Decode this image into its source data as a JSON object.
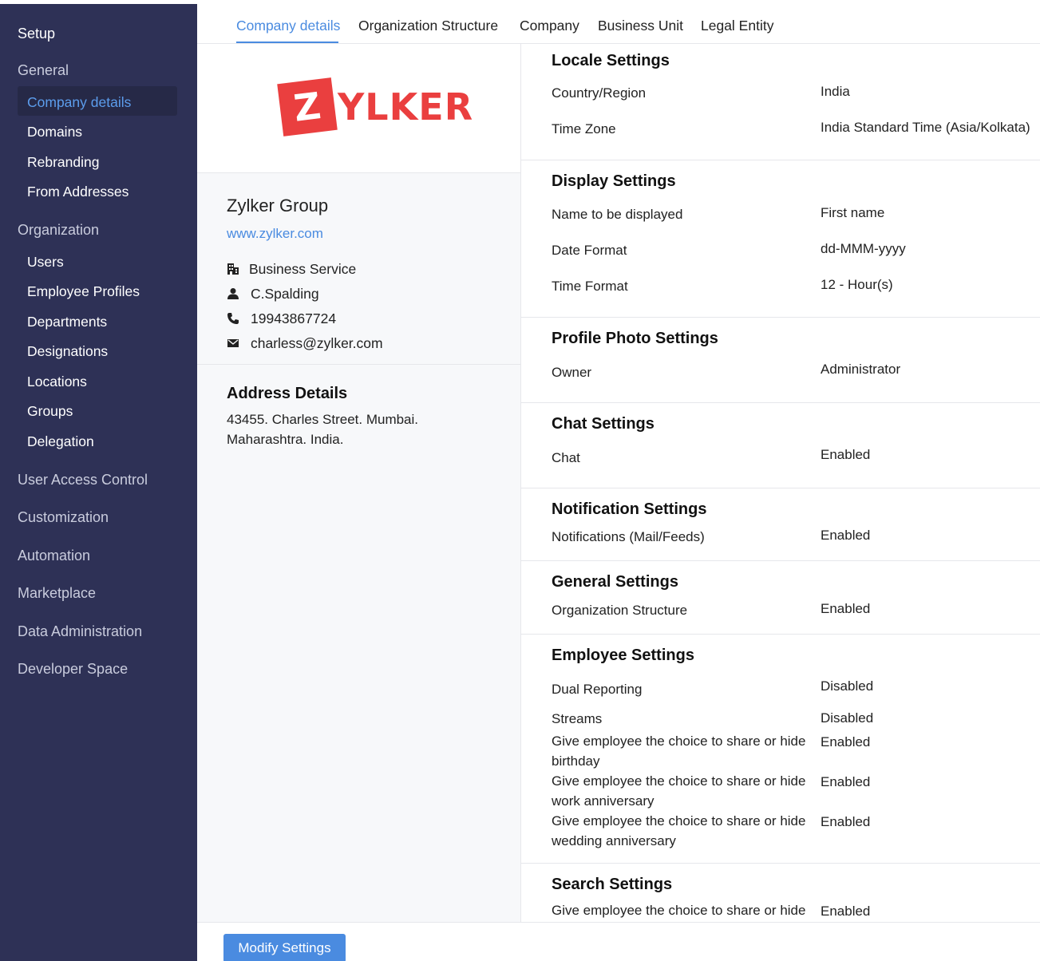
{
  "sidebar": {
    "setup": "Setup",
    "general": "General",
    "general_items": [
      "Company details",
      "Domains",
      "Rebranding",
      "From Addresses"
    ],
    "organization": "Organization",
    "organization_items": [
      "Users",
      "Employee Profiles",
      "Departments",
      "Designations",
      "Locations",
      "Groups",
      "Delegation"
    ],
    "groups": [
      "User Access Control",
      "Customization",
      "Automation",
      "Marketplace",
      "Data Administration",
      "Developer Space"
    ]
  },
  "tabs": [
    "Company details",
    "Organization Structure",
    "Company",
    "Business Unit",
    "Legal Entity"
  ],
  "company": {
    "logo_letter": "Z",
    "logo_text": "YLKER",
    "name": "Zylker Group",
    "url": "www.zylker.com",
    "industry": "Business Service",
    "owner": "C.Spalding",
    "phone": "19943867724",
    "email": "charless@zylker.com",
    "address_title": "Address Details",
    "address_line1": "43455. Charles Street. Mumbai.",
    "address_line2": "Maharashtra. India."
  },
  "settings": {
    "locale": {
      "title": "Locale Settings",
      "rows": [
        [
          "Country/Region",
          "India"
        ],
        [
          "Time Zone",
          "India Standard Time (Asia/Kolkata)"
        ]
      ]
    },
    "display": {
      "title": "Display Settings",
      "rows": [
        [
          "Name to be displayed",
          "First name"
        ],
        [
          "Date Format",
          "dd-MMM-yyyy"
        ],
        [
          "Time Format",
          "12 - Hour(s)"
        ]
      ]
    },
    "profile_photo": {
      "title": "Profile Photo Settings",
      "rows": [
        [
          "Owner",
          "Administrator"
        ]
      ]
    },
    "chat": {
      "title": "Chat Settings",
      "rows": [
        [
          "Chat",
          "Enabled"
        ]
      ]
    },
    "notification": {
      "title": "Notification Settings",
      "rows": [
        [
          "Notifications (Mail/Feeds)",
          "Enabled"
        ]
      ]
    },
    "general": {
      "title": "General Settings",
      "rows": [
        [
          "Organization Structure",
          "Enabled"
        ]
      ]
    },
    "employee": {
      "title": "Employee Settings",
      "rows": [
        [
          "Dual Reporting",
          "Disabled"
        ],
        [
          "Streams",
          "Disabled"
        ],
        [
          "Give employee the choice to share or hide birthday",
          "Enabled"
        ],
        [
          "Give employee the choice to share or hide work anniversary",
          "Enabled"
        ],
        [
          "Give employee the choice to share or hide wedding anniversary",
          "Enabled"
        ]
      ]
    },
    "search": {
      "title": "Search Settings",
      "rows": [
        [
          "Give employee the choice to share or hide",
          "Enabled"
        ]
      ]
    }
  },
  "footer": {
    "modify_button": "Modify Settings"
  },
  "colors": {
    "sidebar_bg": "#2e3156",
    "accent": "#4a8be0",
    "logo_red": "#ea3f3f"
  },
  "icons": {
    "industry": "building-icon",
    "owner": "user-icon",
    "phone": "phone-icon",
    "email": "mail-icon"
  }
}
